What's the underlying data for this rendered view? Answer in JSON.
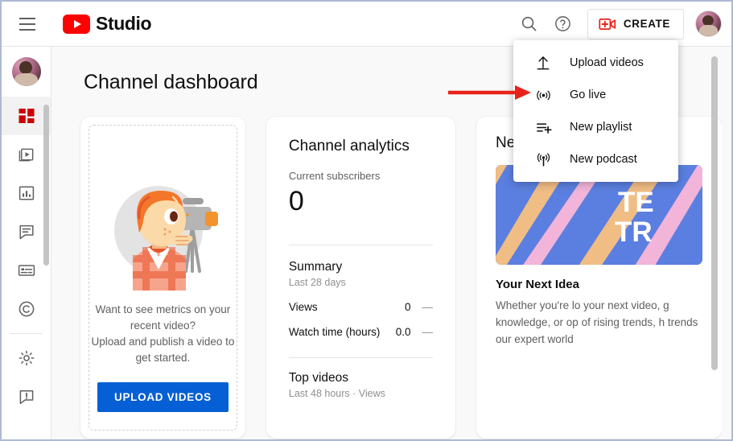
{
  "topbar": {
    "menu_icon": "hamburger-menu-icon",
    "brand": "Studio",
    "search_icon": "search-icon",
    "help_icon": "help-question-icon",
    "create_label": "CREATE",
    "create_icon": "video-camera-plus-icon",
    "avatar": "user-avatar"
  },
  "create_menu": {
    "items": [
      {
        "label": "Upload videos",
        "icon": "upload-arrow-icon"
      },
      {
        "label": "Go live",
        "icon": "broadcast-live-icon"
      },
      {
        "label": "New playlist",
        "icon": "playlist-add-icon"
      },
      {
        "label": "New podcast",
        "icon": "podcast-icon"
      }
    ]
  },
  "sidebar": {
    "items": [
      {
        "name": "dashboard",
        "icon": "dashboard-grid-icon",
        "active": true
      },
      {
        "name": "content",
        "icon": "video-content-icon",
        "active": false
      },
      {
        "name": "analytics",
        "icon": "bar-chart-icon",
        "active": false
      },
      {
        "name": "comments",
        "icon": "comment-bubble-icon",
        "active": false
      },
      {
        "name": "subtitles",
        "icon": "subtitles-icon",
        "active": false
      },
      {
        "name": "copyright",
        "icon": "copyright-icon",
        "active": false
      },
      {
        "name": "settings",
        "icon": "gear-icon",
        "active": false
      },
      {
        "name": "send-feedback",
        "icon": "feedback-exclamation-icon",
        "active": false
      }
    ]
  },
  "page": {
    "title": "Channel dashboard",
    "golive_icon": "broadcast-live-icon"
  },
  "upload_card": {
    "illustration": "person-with-camera-illustration",
    "line1": "Want to see metrics on your recent video?",
    "line2": "Upload and publish a video to get started.",
    "button_label": "UPLOAD VIDEOS"
  },
  "analytics_card": {
    "title": "Channel analytics",
    "subscribers_label": "Current subscribers",
    "subscribers_value": "0",
    "summary_title": "Summary",
    "summary_period": "Last 28 days",
    "metrics": [
      {
        "label": "Views",
        "value": "0",
        "trend": "—"
      },
      {
        "label": "Watch time (hours)",
        "value": "0.0",
        "trend": "—"
      }
    ],
    "top_videos_title": "Top videos",
    "top_videos_sub": "Last 48 hours · Views"
  },
  "news_card": {
    "title": "News",
    "thumbnail_text_line1": "TE",
    "thumbnail_text_line2": "TR",
    "headline": "Your Next Idea",
    "body": "Whether you're lo your next video, g knowledge, or op of rising trends, h trends our expert world"
  },
  "annotation": {
    "arrow": "red-pointer-arrow",
    "color": "#e8221a"
  },
  "colors": {
    "brand_red": "#ff0000",
    "accent_blue": "#065fd4",
    "page_bg": "#f9f9f9"
  }
}
